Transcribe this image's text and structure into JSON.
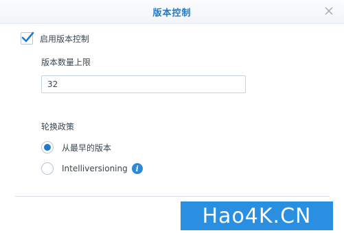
{
  "dialog": {
    "title": "版本控制",
    "close_icon": "close-icon"
  },
  "enable_checkbox": {
    "label": "启用版本控制",
    "checked": true
  },
  "max_versions": {
    "label": "版本数量上限",
    "value": "32"
  },
  "rotation_policy": {
    "label": "轮换政策",
    "options": [
      {
        "label": "从最早的版本",
        "selected": true
      },
      {
        "label": "Intelliversioning",
        "selected": false,
        "info_icon": "info-icon"
      }
    ]
  },
  "watermark": {
    "text": "Hao4K.CN"
  },
  "colors": {
    "accent": "#1f78c8",
    "text": "#3a4750",
    "watermark_bg": "#2a8fe0"
  }
}
